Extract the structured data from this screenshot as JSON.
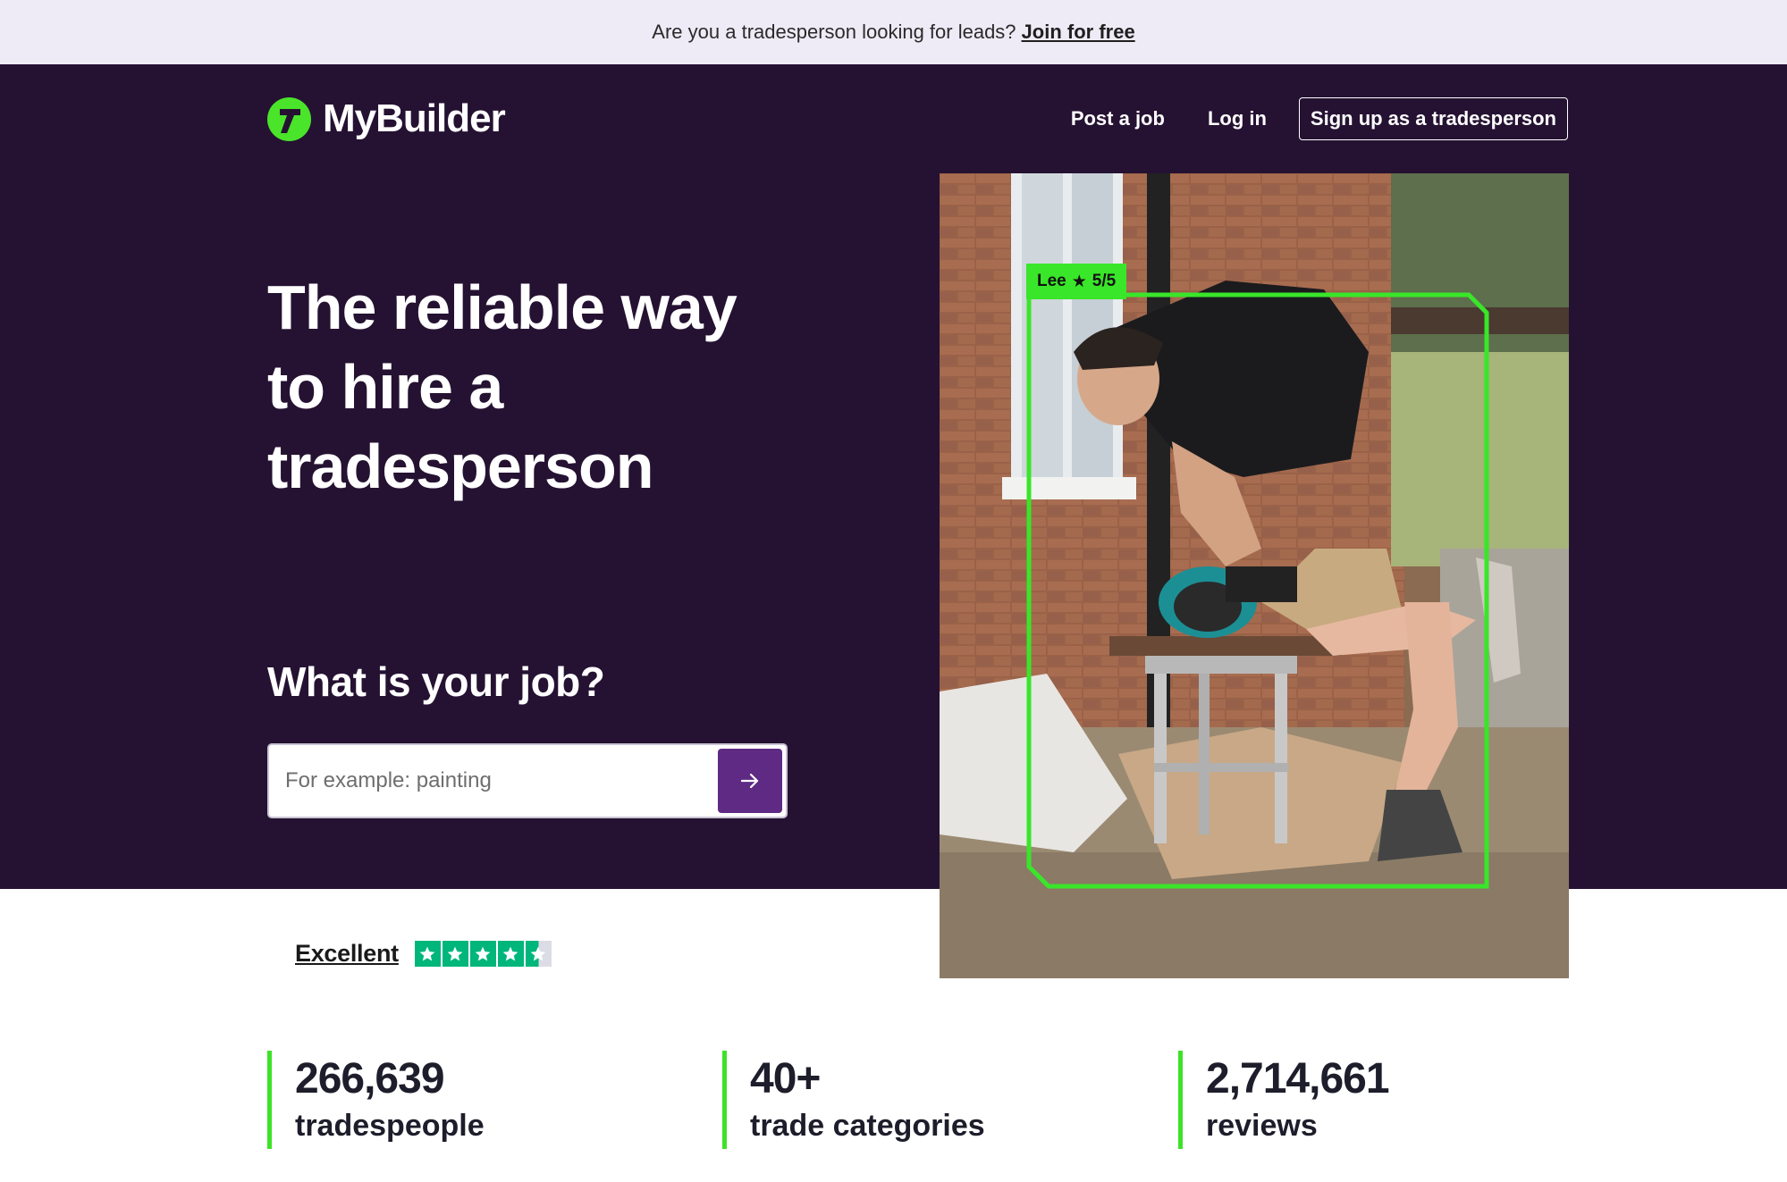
{
  "banner": {
    "text": "Are you a tradesperson looking for leads?",
    "link": "Join for free"
  },
  "header": {
    "logo": "MyBuilder",
    "nav": {
      "post_job": "Post a job",
      "login": "Log in",
      "signup": "Sign up as a tradesperson"
    }
  },
  "hero": {
    "line1": "The reliable way",
    "line2": "to hire a",
    "line3": "tradesperson",
    "job_question": "What is your job?",
    "search": {
      "placeholder": "For example: painting"
    }
  },
  "photo": {
    "tag_name": "Lee",
    "tag_rating": "5/5"
  },
  "trustpilot": {
    "label": "Excellent",
    "stars": 4.5
  },
  "stats": [
    {
      "number": "266,639",
      "label": "tradespeople"
    },
    {
      "number": "40+",
      "label": "trade categories"
    },
    {
      "number": "2,714,661",
      "label": "reviews"
    }
  ],
  "colors": {
    "hero_bg": "#251232",
    "banner_bg": "#efebf6",
    "accent_green": "#3de227",
    "button_purple": "#5e2a84",
    "trustpilot_green": "#00b67a"
  }
}
